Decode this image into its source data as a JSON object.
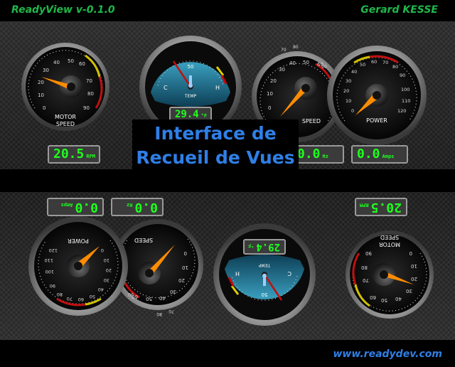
{
  "header": {
    "app_title": "ReadyView v-0.1.0",
    "author": "Gerard KESSE"
  },
  "banner": {
    "line1": "Interface de",
    "line2": "Recueil de Vues"
  },
  "footer": {
    "url": "www.readydev.com"
  },
  "colors": {
    "header_text": "#1fb84a",
    "banner_text": "#2f7fe6",
    "lcd_text": "#1eff1e",
    "needle": "#ff8c00",
    "temp_face": "#1f6f8f"
  },
  "top_panel": {
    "gauges": [
      {
        "name": "motor-speed-gauge",
        "label_line1": "MOTOR",
        "label_line2": "SPEED",
        "ticks": [
          "0",
          "10",
          "20",
          "30",
          "40",
          "50",
          "60",
          "70",
          "80",
          "90"
        ]
      },
      {
        "name": "temp-gauge",
        "label": "TEMP",
        "scale_low": "C",
        "scale_mid": "50",
        "scale_high": "H"
      },
      {
        "name": "speed-gauge",
        "label": "SPEED",
        "ticks": [
          "0",
          "10",
          "20",
          "30",
          "40",
          "50",
          "60",
          "70",
          "80",
          "90"
        ]
      },
      {
        "name": "power-gauge",
        "label": "POWER",
        "ticks": [
          "0",
          "10",
          "20",
          "30",
          "40",
          "50",
          "60",
          "70",
          "80",
          "90",
          "100",
          "110",
          "120"
        ]
      }
    ],
    "displays": {
      "temp": {
        "value": "29.4",
        "unit": "°F"
      },
      "rpm": {
        "value": "20.5",
        "unit": "RPM"
      },
      "hz": {
        "value": "0.0",
        "unit": "Hz"
      },
      "amps": {
        "value": "0.0",
        "unit": "Amps"
      }
    }
  },
  "bottom_panel": {
    "displays": {
      "amps": {
        "value": "0.0",
        "unit": "Amps"
      },
      "hz": {
        "value": "0.0",
        "unit": "Hz"
      },
      "temp": {
        "value": "29.4",
        "unit": "°F"
      },
      "rpm": {
        "value": "20.5",
        "unit": "RPM"
      }
    }
  }
}
